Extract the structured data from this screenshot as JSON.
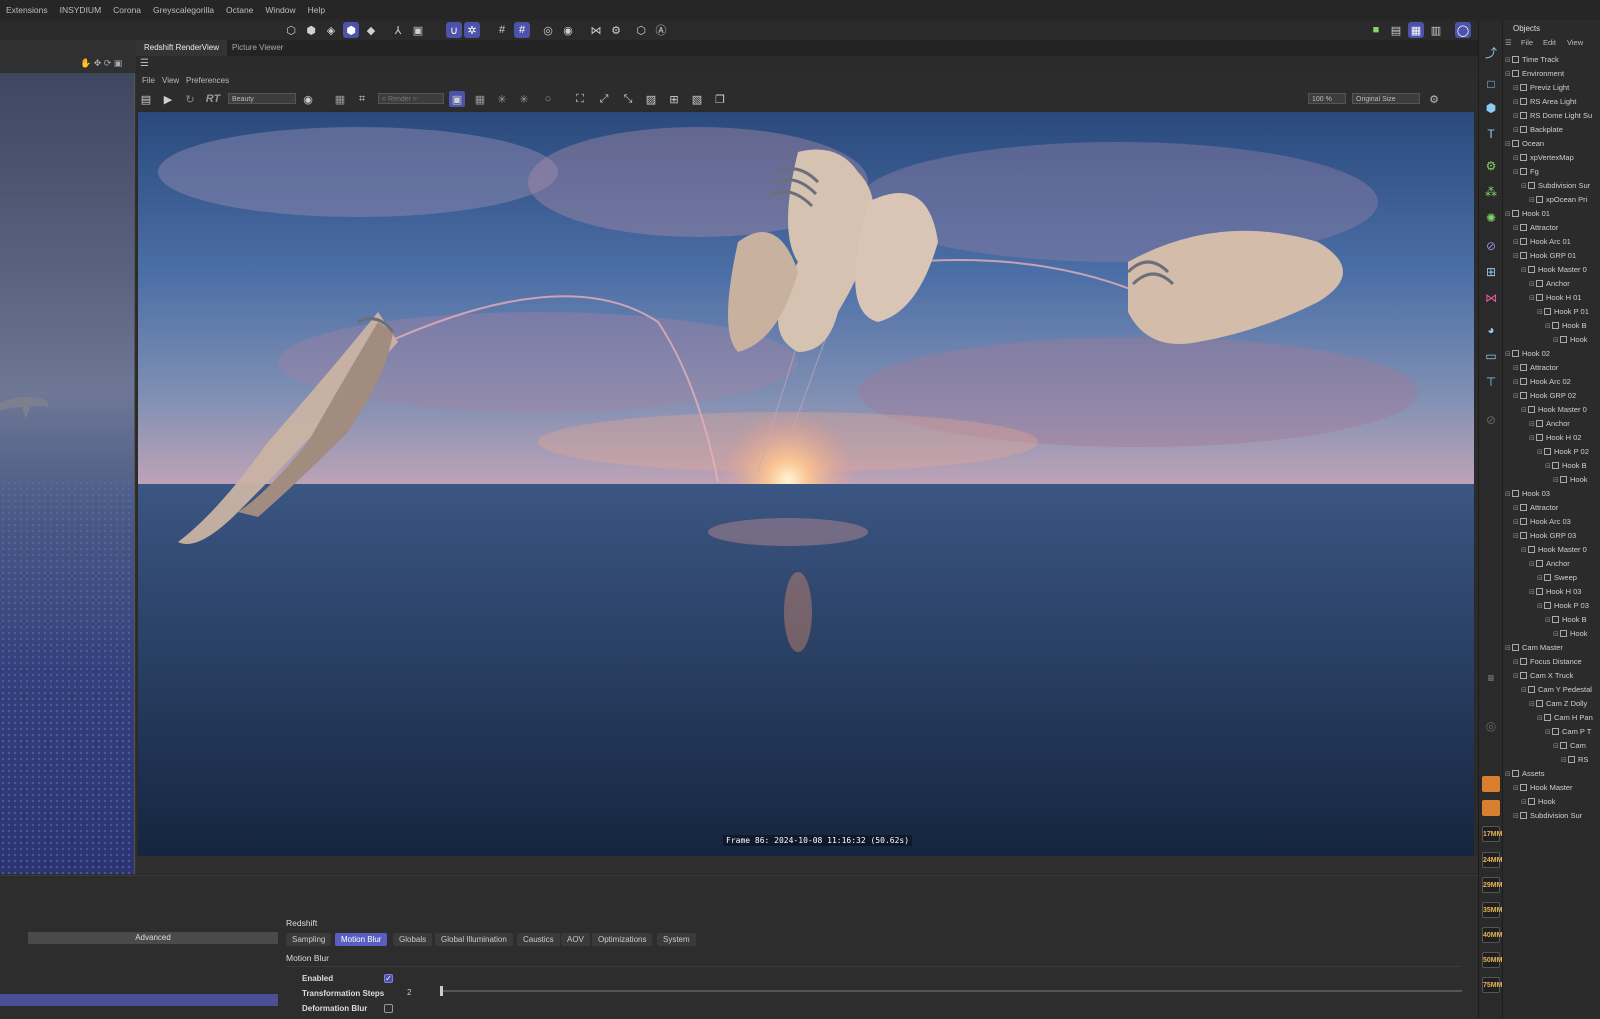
{
  "menu": [
    "Extensions",
    "INSYDIUM",
    "Corona",
    "Greyscalegorilla",
    "Octane",
    "Window",
    "Help"
  ],
  "render_view": {
    "tabs": [
      "Redshift RenderView",
      "Picture Viewer"
    ],
    "menu": [
      "File",
      "View",
      "Preferences"
    ],
    "aov_select": "Beauty",
    "render_select": "< Render >",
    "rt_label": "RT",
    "zoom": "100 %",
    "size_select": "Original Size",
    "frame_info": "Frame  86:  2024-10-08  11:16:32  (50.62s)"
  },
  "attributes": {
    "advanced_label": "Advanced",
    "section": "Redshift",
    "tabs": [
      "Sampling",
      "Motion Blur",
      "Globals",
      "Global Illumination",
      "Caustics",
      "AOV",
      "Optimizations",
      "System"
    ],
    "active_tab": "Motion Blur",
    "group_title": "Motion Blur",
    "enabled_label": "Enabled",
    "enabled": true,
    "steps_label": "Transformation Steps",
    "steps_value": "2",
    "deform_label": "Deformation Blur",
    "deform": false
  },
  "objects": {
    "title": "Objects",
    "menu": [
      "File",
      "Edit",
      "View"
    ],
    "tree": [
      {
        "label": "Time Track",
        "depth": 0
      },
      {
        "label": "Environment",
        "depth": 0
      },
      {
        "label": "Previz Light",
        "depth": 1
      },
      {
        "label": "RS Area Light",
        "depth": 1
      },
      {
        "label": "RS Dome Light Su",
        "depth": 1
      },
      {
        "label": "Backplate",
        "depth": 1
      },
      {
        "label": "Ocean",
        "depth": 0
      },
      {
        "label": "xpVertexMap",
        "depth": 1
      },
      {
        "label": "Fg",
        "depth": 1
      },
      {
        "label": "Subdivision Sur",
        "depth": 2
      },
      {
        "label": "xpOcean Pri",
        "depth": 3
      },
      {
        "label": "Hook 01",
        "depth": 0
      },
      {
        "label": "Attractor",
        "depth": 1
      },
      {
        "label": "Hook Arc 01",
        "depth": 1
      },
      {
        "label": "Hook GRP 01",
        "depth": 1
      },
      {
        "label": "Hook Master 0",
        "depth": 2
      },
      {
        "label": "Anchor",
        "depth": 3
      },
      {
        "label": "Hook H 01",
        "depth": 3
      },
      {
        "label": "Hook P 01",
        "depth": 4
      },
      {
        "label": "Hook B",
        "depth": 5
      },
      {
        "label": "Hook",
        "depth": 6
      },
      {
        "label": "Hook 02",
        "depth": 0
      },
      {
        "label": "Attractor",
        "depth": 1
      },
      {
        "label": "Hook Arc 02",
        "depth": 1
      },
      {
        "label": "Hook GRP 02",
        "depth": 1
      },
      {
        "label": "Hook Master 0",
        "depth": 2
      },
      {
        "label": "Anchor",
        "depth": 3
      },
      {
        "label": "Hook H 02",
        "depth": 3
      },
      {
        "label": "Hook P 02",
        "depth": 4
      },
      {
        "label": "Hook B",
        "depth": 5
      },
      {
        "label": "Hook",
        "depth": 6
      },
      {
        "label": "Hook 03",
        "depth": 0
      },
      {
        "label": "Attractor",
        "depth": 1
      },
      {
        "label": "Hook Arc 03",
        "depth": 1
      },
      {
        "label": "Hook GRP 03",
        "depth": 1
      },
      {
        "label": "Hook Master 0",
        "depth": 2
      },
      {
        "label": "Anchor",
        "depth": 3
      },
      {
        "label": "Sweep",
        "depth": 4
      },
      {
        "label": "Hook H 03",
        "depth": 3
      },
      {
        "label": "Hook P 03",
        "depth": 4
      },
      {
        "label": "Hook B",
        "depth": 5
      },
      {
        "label": "Hook",
        "depth": 6
      },
      {
        "label": "Cam Master",
        "depth": 0
      },
      {
        "label": "Focus Distance",
        "depth": 1
      },
      {
        "label": "Cam X Truck",
        "depth": 1
      },
      {
        "label": "Cam Y Pedestal",
        "depth": 2
      },
      {
        "label": "Cam Z Dolly",
        "depth": 3
      },
      {
        "label": "Cam H Pan",
        "depth": 4
      },
      {
        "label": "Cam P T",
        "depth": 5
      },
      {
        "label": "Cam",
        "depth": 6
      },
      {
        "label": "RS",
        "depth": 7
      },
      {
        "label": "Assets",
        "depth": 0
      },
      {
        "label": "Hook Master",
        "depth": 1
      },
      {
        "label": "Hook",
        "depth": 2
      },
      {
        "label": "Subdivision Sur",
        "depth": 1
      }
    ]
  },
  "lenses": [
    "17MM",
    "24MM",
    "29MM",
    "35MM",
    "40MM",
    "50MM",
    "75MM"
  ],
  "icons": {
    "toolbar": [
      "model-icon",
      "mesh-icon",
      "point-icon",
      "edge-icon",
      "polygon-icon",
      "axis-icon",
      "uv-icon",
      "snap-icon",
      "workplane-icon",
      "grid-icon",
      "grid-snap-icon",
      "solo-icon",
      "viewport-solo-icon",
      "symmetry-icon",
      "settings-icon",
      "octane-icon",
      "render-region-icon"
    ],
    "accent": "#4e52a8",
    "lens_text": "#e7b35a"
  }
}
